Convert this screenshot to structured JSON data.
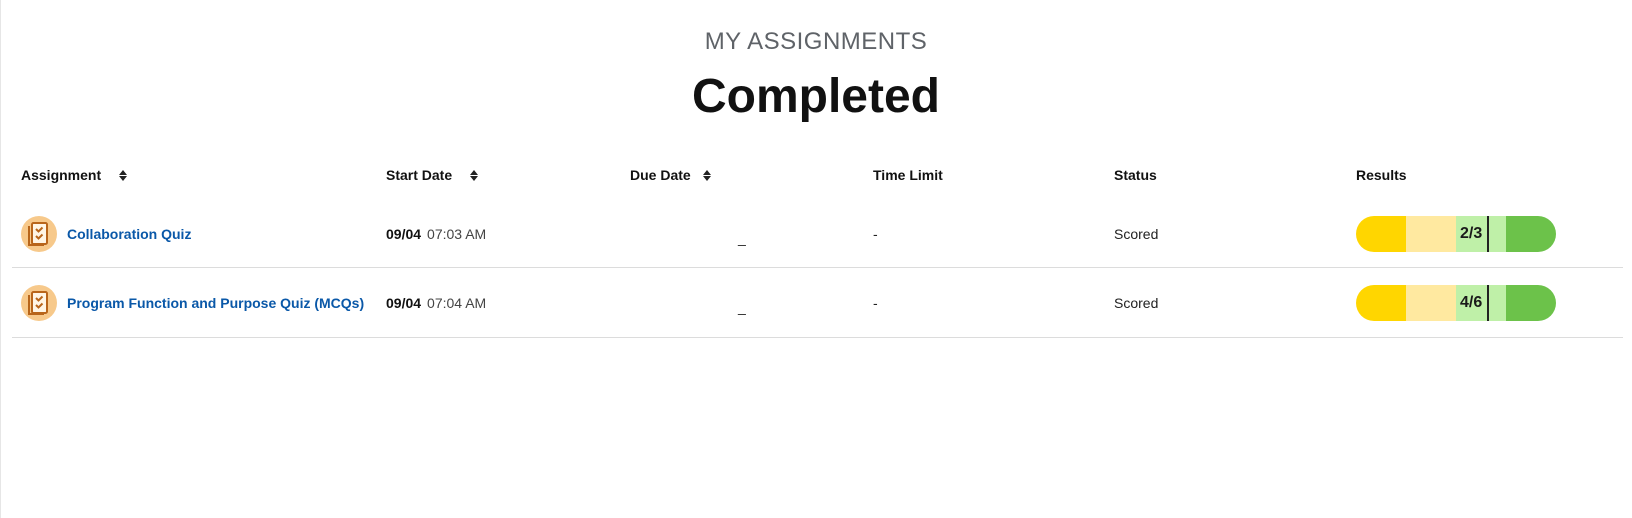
{
  "header": {
    "eyebrow": "MY ASSIGNMENTS",
    "title": "Completed"
  },
  "columns": {
    "assignment": "Assignment",
    "start_date": "Start Date",
    "due_date": "Due Date",
    "time_limit": "Time Limit",
    "status": "Status",
    "results": "Results"
  },
  "rows": [
    {
      "name": "Collaboration Quiz",
      "start_date": "09/04",
      "start_time": "07:03 AM",
      "due_date": "_",
      "time_limit": "-",
      "status": "Scored",
      "result": "2/3",
      "score_fraction": 0.667
    },
    {
      "name": "Program Function and Purpose Quiz (MCQs)",
      "start_date": "09/04",
      "start_time": "07:04 AM",
      "due_date": "_",
      "time_limit": "-",
      "status": "Scored",
      "result": "4/6",
      "score_fraction": 0.667
    }
  ],
  "colors": {
    "link": "#0a58a8",
    "icon_bg": "#f7c98b",
    "icon_fg": "#b8651a",
    "bar_yellow": "#ffd600",
    "bar_light_yellow": "#ffe9a0",
    "bar_light_green": "#bff0a8",
    "bar_green": "#6cc24a"
  },
  "icons": {
    "assignment": "checklist-icon",
    "sort": "sort-icon"
  }
}
